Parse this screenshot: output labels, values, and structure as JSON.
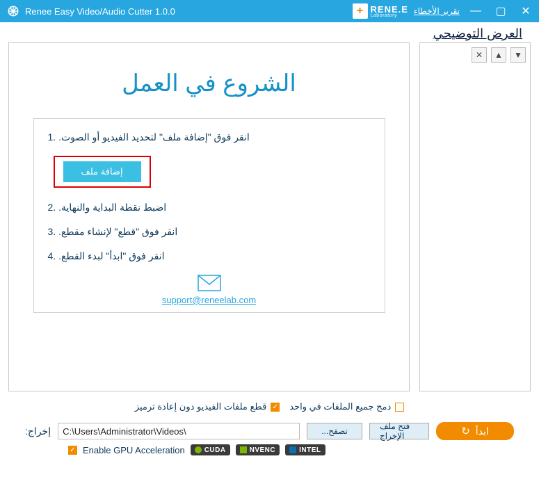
{
  "titlebar": {
    "title": "Renee Easy Video/Audio Cutter 1.0.0",
    "brand_main": "RENE.E",
    "brand_sub": "Laboratory",
    "error_report": "تقرير الأخطاء"
  },
  "demo_link": "العرض التوضيحي",
  "main": {
    "heading": "الشروع في العمل",
    "steps": {
      "s1": ".انقر فوق \"إضافة ملف\" لتحديد الفيديو أو الصوت",
      "s2": ".اضبط نقطة البداية والنهاية",
      "s3": ".انقر فوق \"قطع\" لإنشاء مقطع",
      "s4": ".انقر فوق \"ابدأ\" لبدء القطع"
    },
    "add_file_label": "إضافة ملف",
    "support_email": "support@reneelab.com"
  },
  "options": {
    "merge_all": "دمج جميع الملفات في واحد",
    "cut_no_reencode": "قطع ملفات الفيديو دون إعادة ترميز"
  },
  "output": {
    "label": ":إخراج",
    "value": "C:\\Users\\Administrator\\Videos\\",
    "browse": "...تصفح",
    "open_folder": "فتح ملف الإخراج",
    "start": "ابدأ"
  },
  "gpu": {
    "label": "Enable GPU Acceleration",
    "cuda": "CUDA",
    "nvenc": "NVENC",
    "intel": "INTEL"
  }
}
